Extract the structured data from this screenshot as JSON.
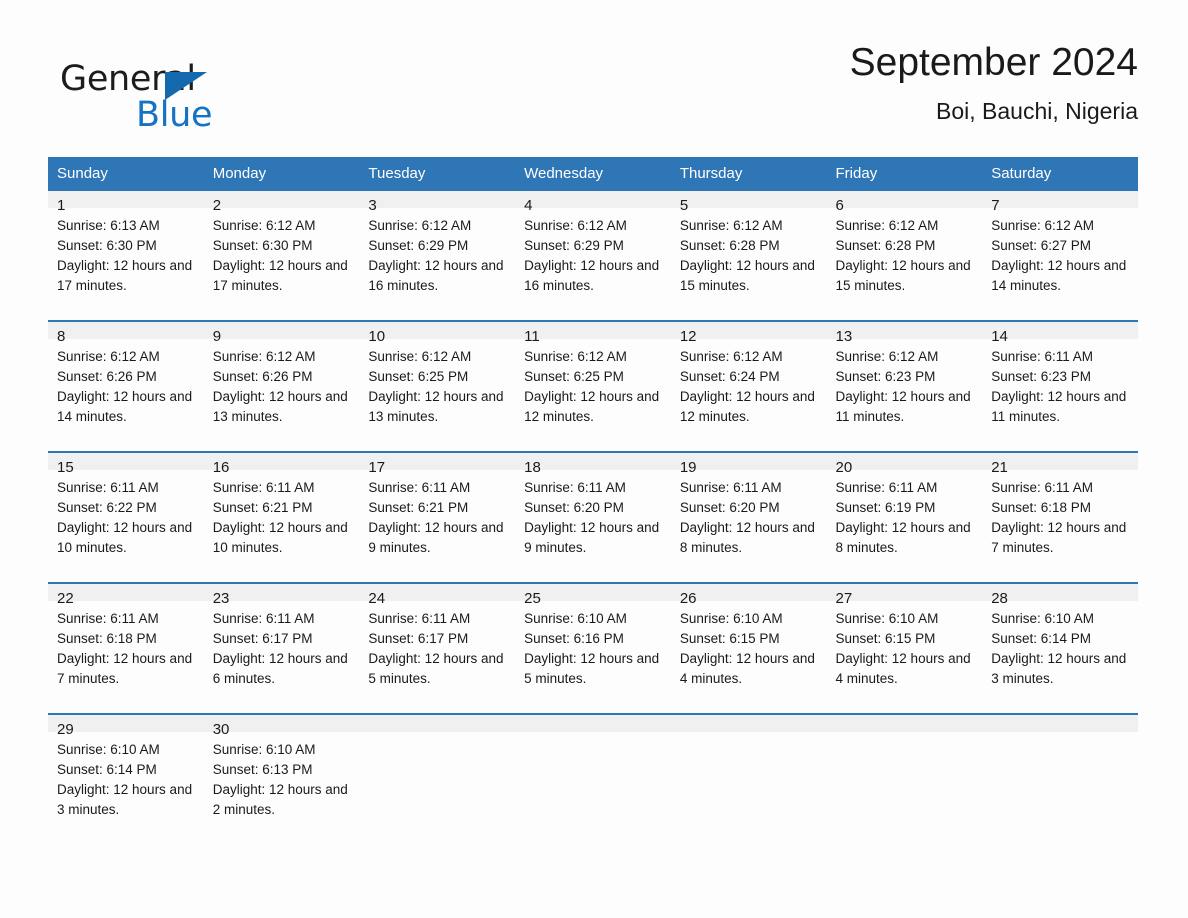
{
  "brand": {
    "word_one": "General",
    "word_two": "Blue",
    "triangle_icon": "triangle-icon",
    "colors": {
      "black": "#1c1c1c",
      "blue": "#1572c4"
    }
  },
  "header": {
    "title": "September 2024",
    "subtitle": "Boi, Bauchi, Nigeria"
  },
  "theme": {
    "header_blue": "#2f76b6",
    "daynum_gray": "#f0f0f0",
    "page_background": "#fdfdfd",
    "text": "#1a1a1a"
  },
  "weekday_headers": [
    "Sunday",
    "Monday",
    "Tuesday",
    "Wednesday",
    "Thursday",
    "Friday",
    "Saturday"
  ],
  "weeks": [
    [
      {
        "day": "1",
        "sunrise": "Sunrise: 6:13 AM",
        "sunset": "Sunset: 6:30 PM",
        "daylight": "Daylight: 12 hours and 17 minutes."
      },
      {
        "day": "2",
        "sunrise": "Sunrise: 6:12 AM",
        "sunset": "Sunset: 6:30 PM",
        "daylight": "Daylight: 12 hours and 17 minutes."
      },
      {
        "day": "3",
        "sunrise": "Sunrise: 6:12 AM",
        "sunset": "Sunset: 6:29 PM",
        "daylight": "Daylight: 12 hours and 16 minutes."
      },
      {
        "day": "4",
        "sunrise": "Sunrise: 6:12 AM",
        "sunset": "Sunset: 6:29 PM",
        "daylight": "Daylight: 12 hours and 16 minutes."
      },
      {
        "day": "5",
        "sunrise": "Sunrise: 6:12 AM",
        "sunset": "Sunset: 6:28 PM",
        "daylight": "Daylight: 12 hours and 15 minutes."
      },
      {
        "day": "6",
        "sunrise": "Sunrise: 6:12 AM",
        "sunset": "Sunset: 6:28 PM",
        "daylight": "Daylight: 12 hours and 15 minutes."
      },
      {
        "day": "7",
        "sunrise": "Sunrise: 6:12 AM",
        "sunset": "Sunset: 6:27 PM",
        "daylight": "Daylight: 12 hours and 14 minutes."
      }
    ],
    [
      {
        "day": "8",
        "sunrise": "Sunrise: 6:12 AM",
        "sunset": "Sunset: 6:26 PM",
        "daylight": "Daylight: 12 hours and 14 minutes."
      },
      {
        "day": "9",
        "sunrise": "Sunrise: 6:12 AM",
        "sunset": "Sunset: 6:26 PM",
        "daylight": "Daylight: 12 hours and 13 minutes."
      },
      {
        "day": "10",
        "sunrise": "Sunrise: 6:12 AM",
        "sunset": "Sunset: 6:25 PM",
        "daylight": "Daylight: 12 hours and 13 minutes."
      },
      {
        "day": "11",
        "sunrise": "Sunrise: 6:12 AM",
        "sunset": "Sunset: 6:25 PM",
        "daylight": "Daylight: 12 hours and 12 minutes."
      },
      {
        "day": "12",
        "sunrise": "Sunrise: 6:12 AM",
        "sunset": "Sunset: 6:24 PM",
        "daylight": "Daylight: 12 hours and 12 minutes."
      },
      {
        "day": "13",
        "sunrise": "Sunrise: 6:12 AM",
        "sunset": "Sunset: 6:23 PM",
        "daylight": "Daylight: 12 hours and 11 minutes."
      },
      {
        "day": "14",
        "sunrise": "Sunrise: 6:11 AM",
        "sunset": "Sunset: 6:23 PM",
        "daylight": "Daylight: 12 hours and 11 minutes."
      }
    ],
    [
      {
        "day": "15",
        "sunrise": "Sunrise: 6:11 AM",
        "sunset": "Sunset: 6:22 PM",
        "daylight": "Daylight: 12 hours and 10 minutes."
      },
      {
        "day": "16",
        "sunrise": "Sunrise: 6:11 AM",
        "sunset": "Sunset: 6:21 PM",
        "daylight": "Daylight: 12 hours and 10 minutes."
      },
      {
        "day": "17",
        "sunrise": "Sunrise: 6:11 AM",
        "sunset": "Sunset: 6:21 PM",
        "daylight": "Daylight: 12 hours and 9 minutes."
      },
      {
        "day": "18",
        "sunrise": "Sunrise: 6:11 AM",
        "sunset": "Sunset: 6:20 PM",
        "daylight": "Daylight: 12 hours and 9 minutes."
      },
      {
        "day": "19",
        "sunrise": "Sunrise: 6:11 AM",
        "sunset": "Sunset: 6:20 PM",
        "daylight": "Daylight: 12 hours and 8 minutes."
      },
      {
        "day": "20",
        "sunrise": "Sunrise: 6:11 AM",
        "sunset": "Sunset: 6:19 PM",
        "daylight": "Daylight: 12 hours and 8 minutes."
      },
      {
        "day": "21",
        "sunrise": "Sunrise: 6:11 AM",
        "sunset": "Sunset: 6:18 PM",
        "daylight": "Daylight: 12 hours and 7 minutes."
      }
    ],
    [
      {
        "day": "22",
        "sunrise": "Sunrise: 6:11 AM",
        "sunset": "Sunset: 6:18 PM",
        "daylight": "Daylight: 12 hours and 7 minutes."
      },
      {
        "day": "23",
        "sunrise": "Sunrise: 6:11 AM",
        "sunset": "Sunset: 6:17 PM",
        "daylight": "Daylight: 12 hours and 6 minutes."
      },
      {
        "day": "24",
        "sunrise": "Sunrise: 6:11 AM",
        "sunset": "Sunset: 6:17 PM",
        "daylight": "Daylight: 12 hours and 5 minutes."
      },
      {
        "day": "25",
        "sunrise": "Sunrise: 6:10 AM",
        "sunset": "Sunset: 6:16 PM",
        "daylight": "Daylight: 12 hours and 5 minutes."
      },
      {
        "day": "26",
        "sunrise": "Sunrise: 6:10 AM",
        "sunset": "Sunset: 6:15 PM",
        "daylight": "Daylight: 12 hours and 4 minutes."
      },
      {
        "day": "27",
        "sunrise": "Sunrise: 6:10 AM",
        "sunset": "Sunset: 6:15 PM",
        "daylight": "Daylight: 12 hours and 4 minutes."
      },
      {
        "day": "28",
        "sunrise": "Sunrise: 6:10 AM",
        "sunset": "Sunset: 6:14 PM",
        "daylight": "Daylight: 12 hours and 3 minutes."
      }
    ],
    [
      {
        "day": "29",
        "sunrise": "Sunrise: 6:10 AM",
        "sunset": "Sunset: 6:14 PM",
        "daylight": "Daylight: 12 hours and 3 minutes."
      },
      {
        "day": "30",
        "sunrise": "Sunrise: 6:10 AM",
        "sunset": "Sunset: 6:13 PM",
        "daylight": "Daylight: 12 hours and 2 minutes."
      },
      {
        "day": "",
        "sunrise": "",
        "sunset": "",
        "daylight": ""
      },
      {
        "day": "",
        "sunrise": "",
        "sunset": "",
        "daylight": ""
      },
      {
        "day": "",
        "sunrise": "",
        "sunset": "",
        "daylight": ""
      },
      {
        "day": "",
        "sunrise": "",
        "sunset": "",
        "daylight": ""
      },
      {
        "day": "",
        "sunrise": "",
        "sunset": "",
        "daylight": ""
      }
    ]
  ]
}
